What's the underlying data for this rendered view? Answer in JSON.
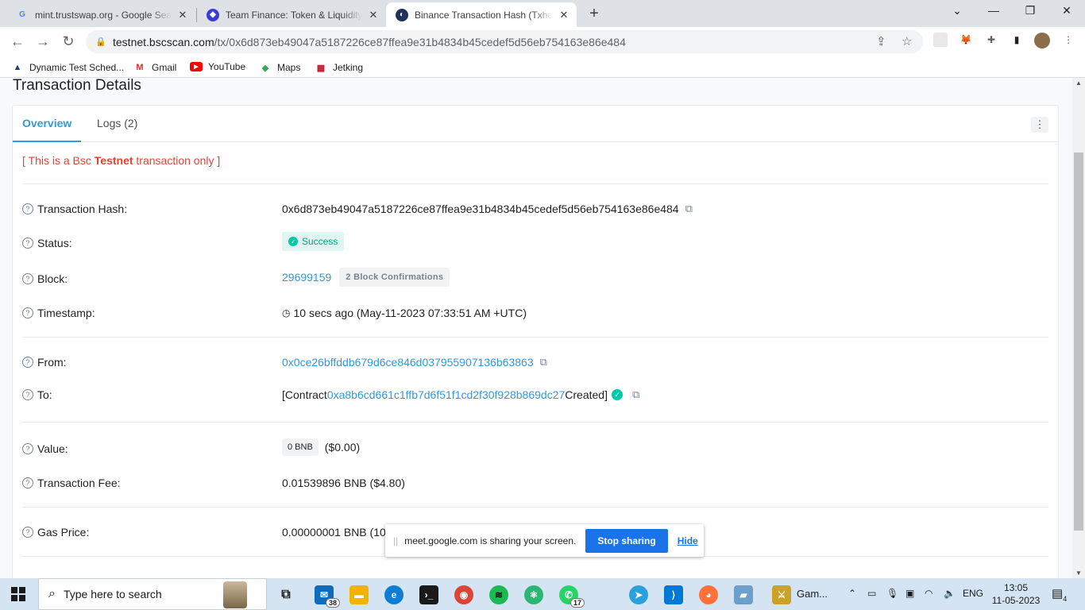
{
  "browser": {
    "tabs": [
      {
        "title": "mint.trustswap.org - Google Search",
        "favicon": "google-icon"
      },
      {
        "title": "Team Finance: Token & Liquidity Locks",
        "favicon": "team-finance-icon"
      },
      {
        "title": "Binance Transaction Hash (Txhash) Details",
        "favicon": "bscscan-icon"
      }
    ],
    "url_domain": "testnet.bscscan.com",
    "url_path": "/tx/0x6d873eb49047a5187226ce87ffea9e31b4834b45cedef5d56eb754163e86e484",
    "bookmarks": [
      "Dynamic Test Sched...",
      "Gmail",
      "YouTube",
      "Maps",
      "Jetking"
    ]
  },
  "page": {
    "title": "Transaction Details",
    "tabs": {
      "overview": "Overview",
      "logs": "Logs (2)"
    },
    "notice_pre": "[ This is a Bsc ",
    "notice_bold": "Testnet",
    "notice_post": " transaction only ]",
    "fields": {
      "hash_label": "Transaction Hash:",
      "hash_value": "0x6d873eb49047a5187226ce87ffea9e31b4834b45cedef5d56eb754163e86e484",
      "status_label": "Status:",
      "status_value": "Success",
      "block_label": "Block:",
      "block_value": "29699159",
      "block_confirmations": "2 Block Confirmations",
      "timestamp_label": "Timestamp:",
      "timestamp_value": "10 secs ago (May-11-2023 07:33:51 AM +UTC)",
      "from_label": "From:",
      "from_value": "0x0ce26bffddb679d6ce846d037955907136b63863",
      "to_label": "To:",
      "to_pre": "[Contract ",
      "to_value": "0xa8b6cd661c1ffb7d6f51f1cd2f30f928b869dc27",
      "to_post": " Created]",
      "value_label": "Value:",
      "value_bnb": "0 BNB",
      "value_usd": "($0.00)",
      "fee_label": "Transaction Fee:",
      "fee_value": "0.01539896 BNB ($4.80)",
      "gas_label": "Gas Price:",
      "gas_value": "0.00000001 BNB (10 Gwei)"
    }
  },
  "share_bar": {
    "message": "meet.google.com is sharing your screen.",
    "stop_label": "Stop sharing",
    "hide_label": "Hide"
  },
  "taskbar": {
    "search_placeholder": "Type here to search",
    "mail_count": "38",
    "whatsapp_count": "17",
    "game_label": "Gam...",
    "language": "ENG",
    "time": "13:05",
    "date": "11-05-2023",
    "notification_count": "4"
  },
  "colors": {
    "link": "#3498db",
    "success": "#00a186",
    "notice": "#de4437",
    "share_button": "#1a73e8"
  }
}
